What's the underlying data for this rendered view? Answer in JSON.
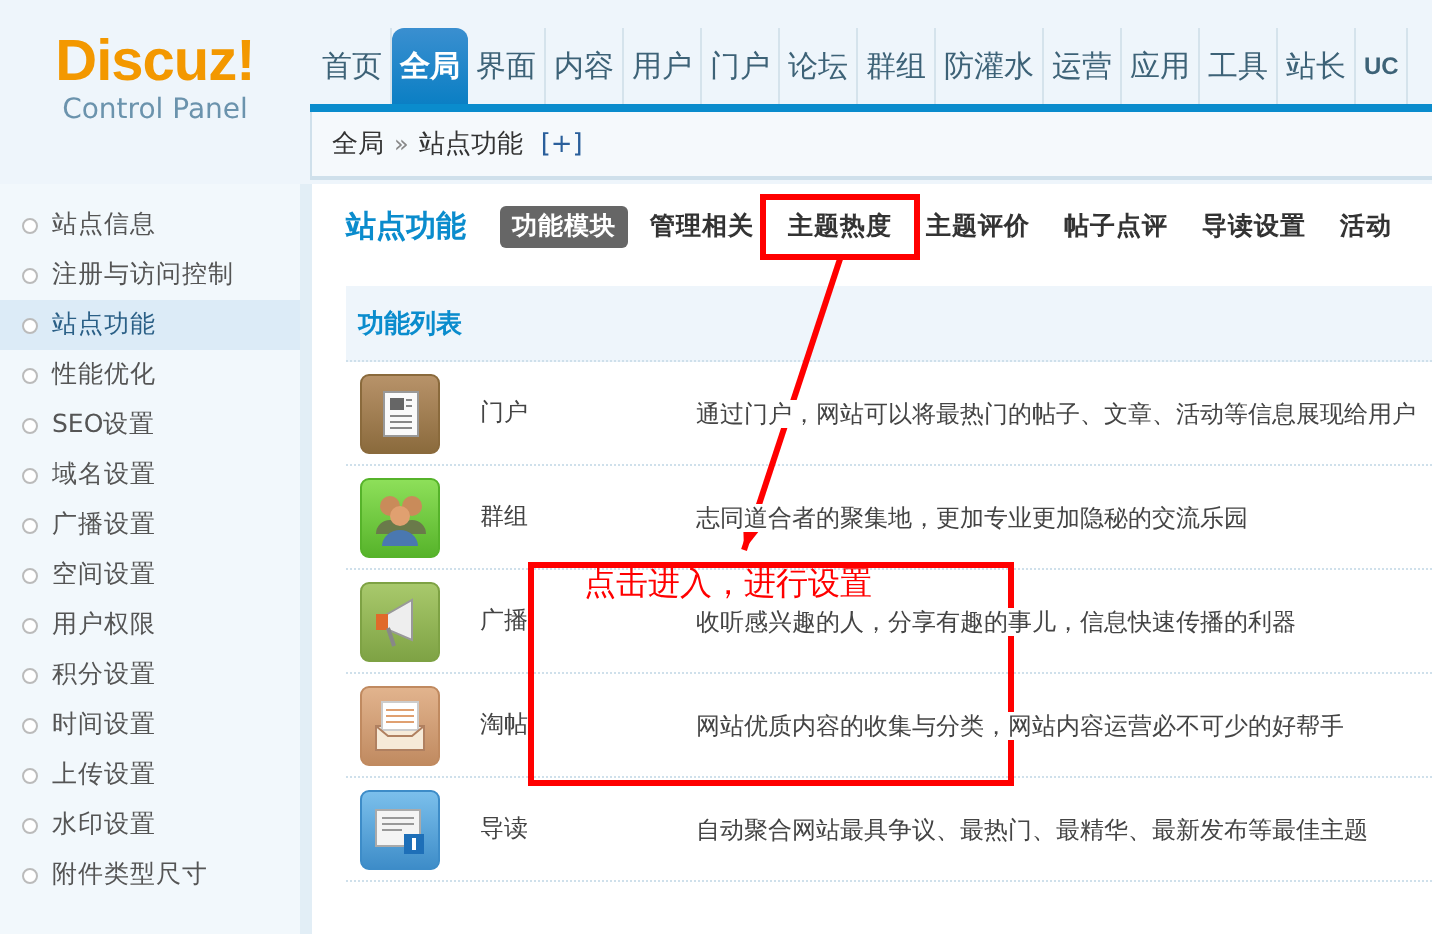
{
  "logo": {
    "name": "Discuz!",
    "subtitle": "Control Panel"
  },
  "nav": [
    {
      "label": "首页",
      "selected": false
    },
    {
      "label": "全局",
      "selected": true
    },
    {
      "label": "界面",
      "selected": false
    },
    {
      "label": "内容",
      "selected": false
    },
    {
      "label": "用户",
      "selected": false
    },
    {
      "label": "门户",
      "selected": false
    },
    {
      "label": "论坛",
      "selected": false
    },
    {
      "label": "群组",
      "selected": false
    },
    {
      "label": "防灌水",
      "selected": false
    },
    {
      "label": "运营",
      "selected": false
    },
    {
      "label": "应用",
      "selected": false
    },
    {
      "label": "工具",
      "selected": false
    },
    {
      "label": "站长",
      "selected": false
    },
    {
      "label": "UC",
      "selected": false
    }
  ],
  "breadcrumb": {
    "items": [
      "全局",
      "站点功能"
    ],
    "separator": "»",
    "action": "[+]"
  },
  "sidebar": {
    "items": [
      {
        "label": "站点信息",
        "selected": false
      },
      {
        "label": "注册与访问控制",
        "selected": false
      },
      {
        "label": "站点功能",
        "selected": true
      },
      {
        "label": "性能优化",
        "selected": false
      },
      {
        "label": "SEO设置",
        "selected": false
      },
      {
        "label": "域名设置",
        "selected": false
      },
      {
        "label": "广播设置",
        "selected": false
      },
      {
        "label": "空间设置",
        "selected": false
      },
      {
        "label": "用户权限",
        "selected": false
      },
      {
        "label": "积分设置",
        "selected": false
      },
      {
        "label": "时间设置",
        "selected": false
      },
      {
        "label": "上传设置",
        "selected": false
      },
      {
        "label": "水印设置",
        "selected": false
      },
      {
        "label": "附件类型尺寸",
        "selected": false
      }
    ]
  },
  "page_title": "站点功能",
  "tabs": [
    {
      "label": "功能模块",
      "selected": true,
      "highlighted": false
    },
    {
      "label": "管理相关",
      "selected": false,
      "highlighted": false
    },
    {
      "label": "主题热度",
      "selected": false,
      "highlighted": true
    },
    {
      "label": "主题评价",
      "selected": false,
      "highlighted": false
    },
    {
      "label": "帖子点评",
      "selected": false,
      "highlighted": false
    },
    {
      "label": "导读设置",
      "selected": false,
      "highlighted": false
    },
    {
      "label": "活动",
      "selected": false,
      "highlighted": false
    }
  ],
  "section_title": "功能列表",
  "features": [
    {
      "kind": "portal",
      "name": "门户",
      "description": "通过门户，网站可以将最热门的帖子、文章、活动等信息展现给用户"
    },
    {
      "kind": "group",
      "name": "群组",
      "description": "志同道合者的聚集地，更加专业更加隐秘的交流乐园"
    },
    {
      "kind": "broadcast",
      "name": "广播",
      "description": "收听感兴趣的人，分享有趣的事儿，信息快速传播的利器"
    },
    {
      "kind": "collection",
      "name": "淘帖",
      "description": "网站优质内容的收集与分类，网站内容运营必不可少的好帮手"
    },
    {
      "kind": "guide",
      "name": "导读",
      "description": "自动聚合网站最具争议、最热门、最精华、最新发布等最佳主题"
    }
  ],
  "annotation": {
    "text": "点击进入，进行设置"
  }
}
